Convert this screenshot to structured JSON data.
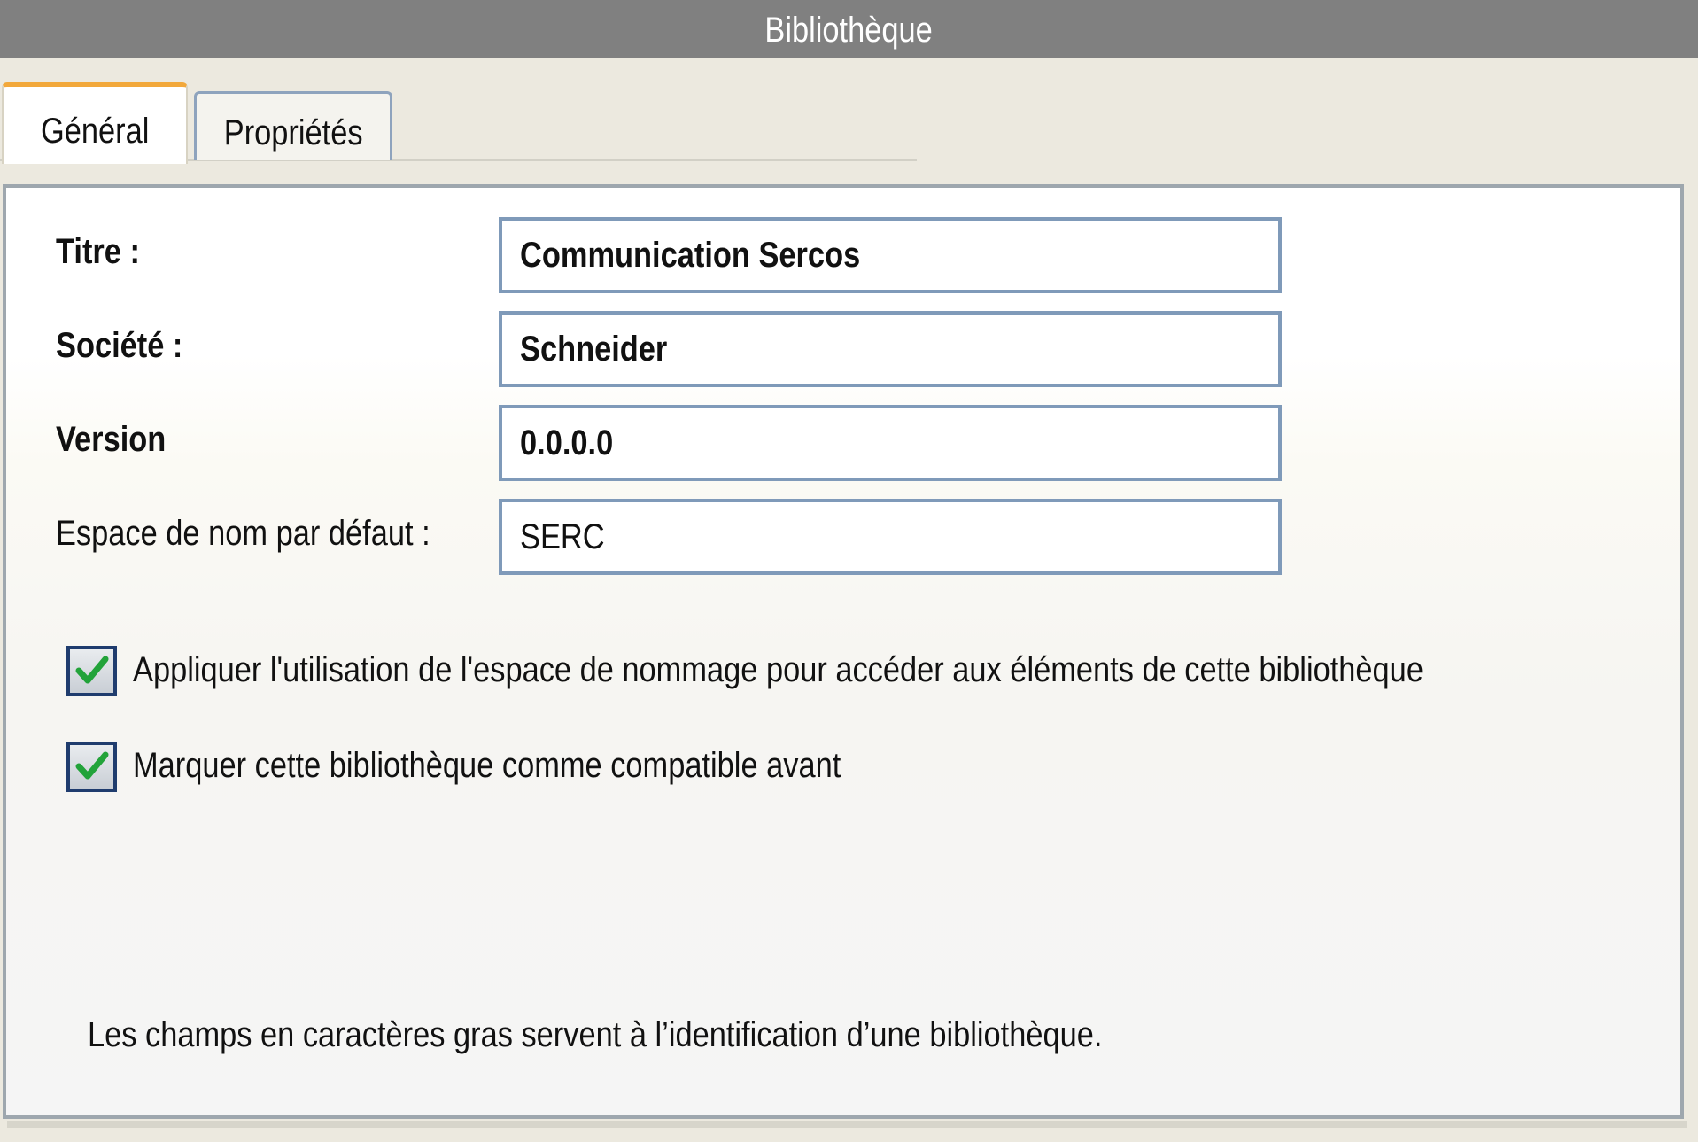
{
  "window": {
    "title": "Bibliothèque"
  },
  "tabs": [
    {
      "label": "Général",
      "active": true
    },
    {
      "label": "Propriétés",
      "active": false
    }
  ],
  "fields": {
    "title": {
      "label": "Titre :",
      "value": "Communication Sercos"
    },
    "company": {
      "label": "Société :",
      "value": "Schneider"
    },
    "version": {
      "label": "Version",
      "value": "0.0.0.0"
    },
    "namespace": {
      "label": "Espace de nom par défaut :",
      "value": "SERC"
    }
  },
  "checkboxes": [
    {
      "label": "Appliquer l'utilisation de l'espace de nommage pour accéder aux éléments de cette bibliothèque",
      "checked": true
    },
    {
      "label": "Marquer cette bibliothèque comme compatible avant",
      "checked": true
    }
  ],
  "note": "Les champs en caractères gras servent à l’identification d’une bibliothèque.",
  "colors": {
    "titlebar": "#808080",
    "active_tab_accent": "#f2a83b",
    "field_border": "#7f9ab9",
    "checkbox_border": "#1f3c6e",
    "checkmark": "#22a33a"
  }
}
